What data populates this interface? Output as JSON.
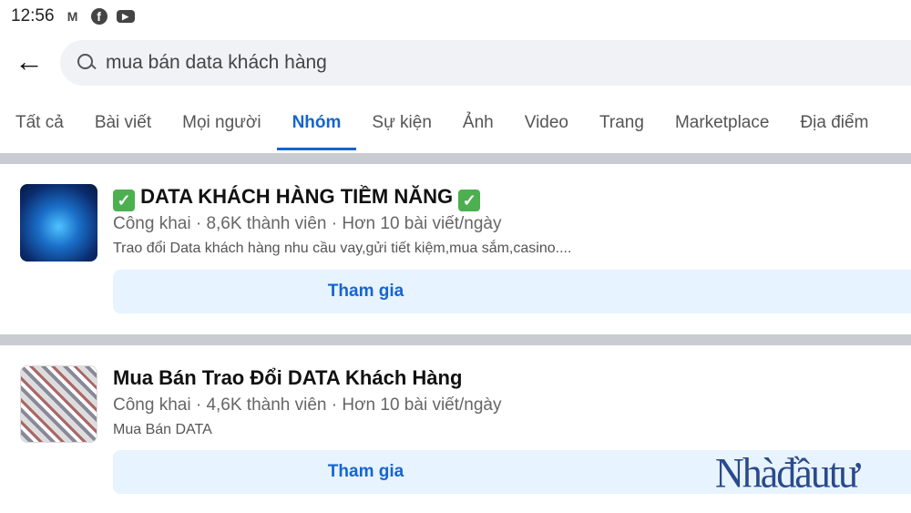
{
  "status": {
    "time": "12:56",
    "icons": [
      "gmail-icon",
      "facebook-icon",
      "youtube-icon"
    ]
  },
  "search": {
    "value": "mua bán data khách hàng"
  },
  "tabs": [
    {
      "label": "Tất cả"
    },
    {
      "label": "Bài viết"
    },
    {
      "label": "Mọi người"
    },
    {
      "label": "Nhóm",
      "active": true
    },
    {
      "label": "Sự kiện"
    },
    {
      "label": "Ảnh"
    },
    {
      "label": "Video"
    },
    {
      "label": "Trang"
    },
    {
      "label": "Marketplace"
    },
    {
      "label": "Địa điểm"
    }
  ],
  "results": [
    {
      "title": "DATA KHÁCH HÀNG TIỀM NĂNG",
      "meta": "Công khai · 8,6K thành viên · Hơn 10 bài viết/ngày",
      "desc": "Trao đổi Data khách hàng nhu cầu vay,gửi tiết kiệm,mua sắm,casino....",
      "join": "Tham gia"
    },
    {
      "title": "Mua Bán Trao Đổi DATA Khách Hàng",
      "meta": "Công khai · 4,6K thành viên · Hơn 10 bài viết/ngày",
      "desc": "Mua Bán DATA",
      "join": "Tham gia"
    }
  ],
  "watermark": "Nhàđầutư",
  "colors": {
    "accent": "#1465d1",
    "join_bg": "#e7f3ff"
  }
}
